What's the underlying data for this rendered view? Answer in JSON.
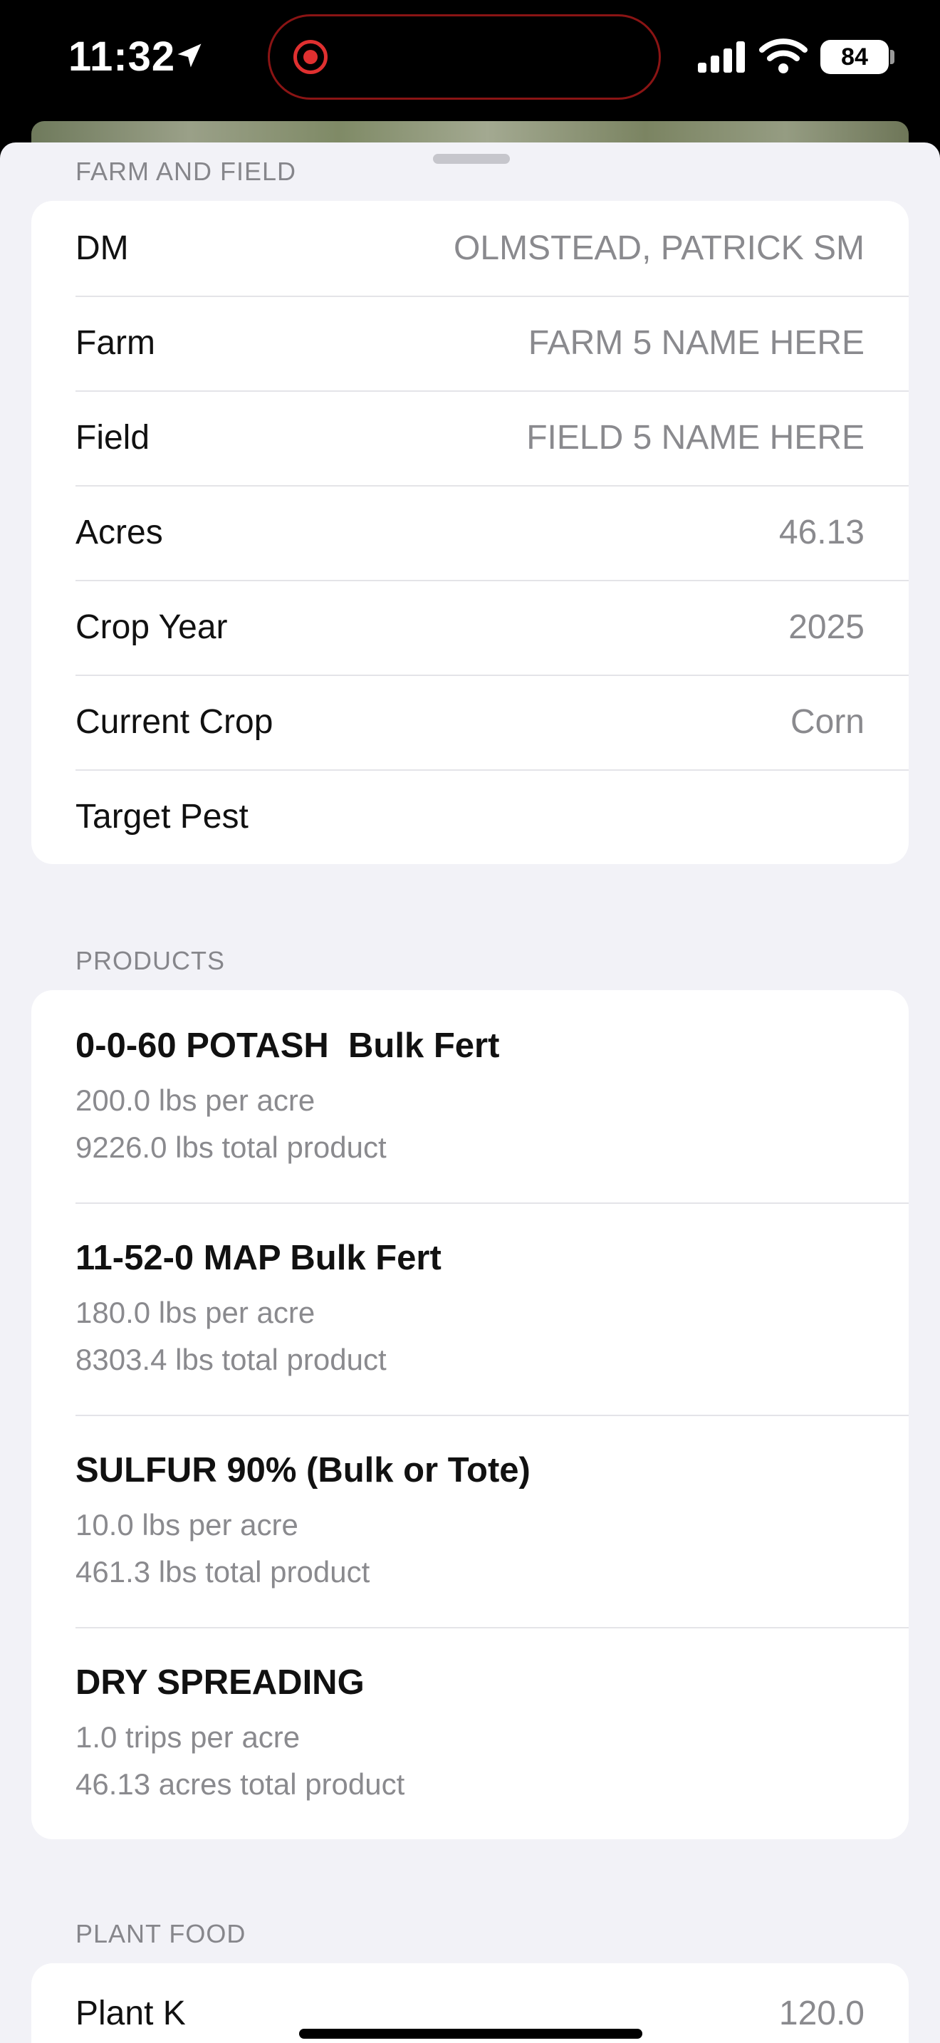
{
  "status_bar": {
    "time": "11:32",
    "battery": "84",
    "location_icon": "location-arrow-icon",
    "signal_icon": "cellular-signal-icon",
    "wifi_icon": "wifi-icon",
    "recording_icon": "screen-recording-icon"
  },
  "farm_section": {
    "header": "FARM AND FIELD",
    "rows": [
      {
        "label": "DM",
        "value": "OLMSTEAD, PATRICK SM"
      },
      {
        "label": "Farm",
        "value": "FARM 5 NAME HERE"
      },
      {
        "label": "Field",
        "value": "FIELD 5 NAME HERE"
      },
      {
        "label": "Acres",
        "value": "46.13"
      },
      {
        "label": "Crop Year",
        "value": "2025"
      },
      {
        "label": "Current Crop",
        "value": "Corn"
      },
      {
        "label": "Target Pest",
        "value": ""
      }
    ]
  },
  "products_section": {
    "header": "PRODUCTS",
    "items": [
      {
        "name": "0-0-60 POTASH  Bulk Fert",
        "rate": "200.0 lbs per acre",
        "total": "9226.0 lbs total product"
      },
      {
        "name": "11-52-0 MAP Bulk Fert",
        "rate": "180.0 lbs per acre",
        "total": "8303.4 lbs total product"
      },
      {
        "name": "SULFUR 90% (Bulk or Tote)",
        "rate": "10.0 lbs per acre",
        "total": "461.3 lbs total product"
      },
      {
        "name": "DRY SPREADING",
        "rate": "1.0 trips per acre",
        "total": "46.13 acres total product"
      }
    ]
  },
  "plant_food_section": {
    "header": "PLANT FOOD",
    "rows": [
      {
        "label": "Plant K",
        "value": "120.0"
      }
    ]
  },
  "colors": {
    "background": "#f2f2f7",
    "card": "#ffffff",
    "secondary_text": "#8a8a8e",
    "recording": "#e03030"
  }
}
